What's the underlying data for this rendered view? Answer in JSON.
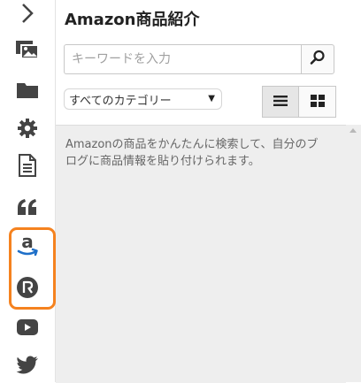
{
  "colors": {
    "icon": "#444444",
    "highlight_border": "#f5821f",
    "results_background": "#eeeeee"
  },
  "sidebar": {
    "items": [
      {
        "icon": "chevron-right-icon"
      },
      {
        "icon": "gallery-icon"
      },
      {
        "icon": "folder-icon"
      },
      {
        "icon": "gear-icon"
      },
      {
        "icon": "document-icon"
      },
      {
        "icon": "quote-icon"
      },
      {
        "icon": "amazon-icon"
      },
      {
        "icon": "rakuten-icon"
      },
      {
        "icon": "youtube-icon"
      },
      {
        "icon": "twitter-icon"
      }
    ],
    "highlighted": [
      "amazon-icon",
      "rakuten-icon"
    ]
  },
  "panel": {
    "title": "Amazon商品紹介",
    "search": {
      "placeholder": "キーワードを入力",
      "value": ""
    },
    "category": {
      "selected": "すべてのカテゴリー"
    },
    "view_modes": [
      "list",
      "grid"
    ],
    "active_view": "list",
    "message": "Amazonの商品をかんたんに検索して、自分のブログに商品情報を貼り付けられます。"
  }
}
